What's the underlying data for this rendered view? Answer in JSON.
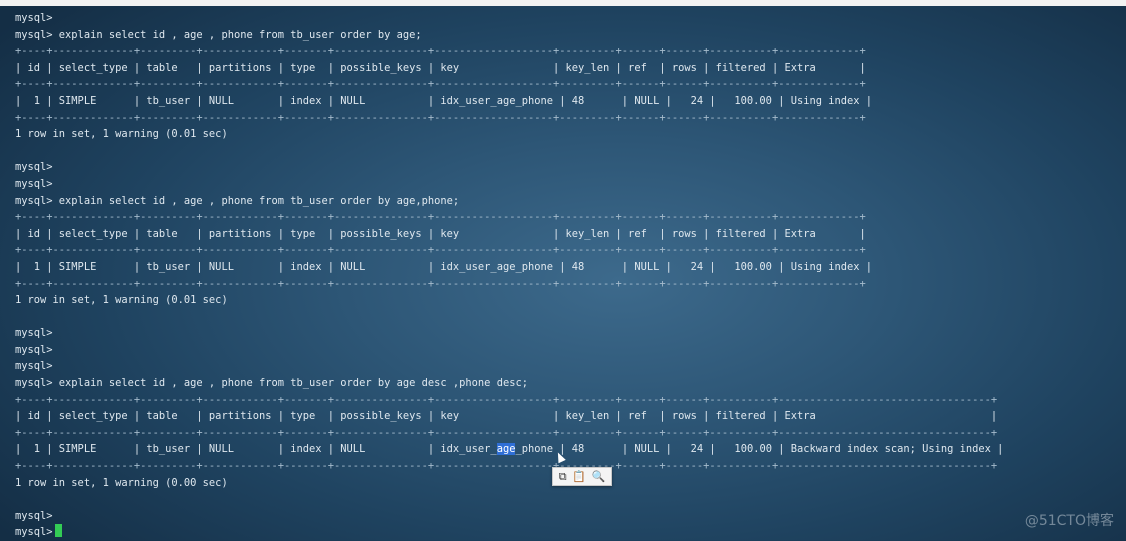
{
  "terminal": {
    "lines": [
      {
        "text": "mysql>",
        "kind": "prompt"
      },
      {
        "text": "mysql> explain select id , age , phone from tb_user order by age;",
        "kind": "prompt"
      },
      {
        "text": "+----+-------------+---------+------------+-------+---------------+-------------------+---------+------+------+----------+-------------+",
        "kind": "border"
      },
      {
        "text": "| id | select_type | table   | partitions | type  | possible_keys | key               | key_len | ref  | rows | filtered | Extra       |",
        "kind": "header"
      },
      {
        "text": "+----+-------------+---------+------------+-------+---------------+-------------------+---------+------+------+----------+-------------+",
        "kind": "border"
      },
      {
        "text": "|  1 | SIMPLE      | tb_user | NULL       | index | NULL          | idx_user_age_phone | 48      | NULL |   24 |   100.00 | Using index |",
        "kind": "row"
      },
      {
        "text": "+----+-------------+---------+------------+-------+---------------+-------------------+---------+------+------+----------+-------------+",
        "kind": "border"
      },
      {
        "text": "1 row in set, 1 warning (0.01 sec)",
        "kind": "output"
      },
      {
        "text": "",
        "kind": "blank"
      },
      {
        "text": "mysql>",
        "kind": "prompt"
      },
      {
        "text": "mysql>",
        "kind": "prompt"
      },
      {
        "text": "mysql> explain select id , age , phone from tb_user order by age,phone;",
        "kind": "prompt"
      },
      {
        "text": "+----+-------------+---------+------------+-------+---------------+-------------------+---------+------+------+----------+-------------+",
        "kind": "border"
      },
      {
        "text": "| id | select_type | table   | partitions | type  | possible_keys | key               | key_len | ref  | rows | filtered | Extra       |",
        "kind": "header"
      },
      {
        "text": "+----+-------------+---------+------------+-------+---------------+-------------------+---------+------+------+----------+-------------+",
        "kind": "border"
      },
      {
        "text": "|  1 | SIMPLE      | tb_user | NULL       | index | NULL          | idx_user_age_phone | 48      | NULL |   24 |   100.00 | Using index |",
        "kind": "row"
      },
      {
        "text": "+----+-------------+---------+------------+-------+---------------+-------------------+---------+------+------+----------+-------------+",
        "kind": "border"
      },
      {
        "text": "1 row in set, 1 warning (0.01 sec)",
        "kind": "output"
      },
      {
        "text": "",
        "kind": "blank"
      },
      {
        "text": "mysql>",
        "kind": "prompt"
      },
      {
        "text": "mysql>",
        "kind": "prompt"
      },
      {
        "text": "mysql>",
        "kind": "prompt"
      },
      {
        "text": "mysql> explain select id , age , phone from tb_user order by age desc ,phone desc;",
        "kind": "prompt"
      },
      {
        "text": "+----+-------------+---------+------------+-------+---------------+-------------------+---------+------+------+----------+----------------------------------+",
        "kind": "border"
      },
      {
        "text": "| id | select_type | table   | partitions | type  | possible_keys | key               | key_len | ref  | rows | filtered | Extra                            |",
        "kind": "header"
      },
      {
        "text": "+----+-------------+---------+------------+-------+---------------+-------------------+---------+------+------+----------+----------------------------------+",
        "kind": "border"
      },
      {
        "text_before": "|  1 | SIMPLE      | tb_user | NULL       | index | NULL          | idx_user_",
        "selected": "age",
        "text_after": "_phone | 48      | NULL |   24 |   100.00 | Backward index scan; Using index |",
        "kind": "row-selected"
      },
      {
        "text": "+----+-------------+---------+------------+-------+---------------+-------------------+---------+------+------+----------+----------------------------------+",
        "kind": "border"
      },
      {
        "text": "1 row in set, 1 warning (0.00 sec)",
        "kind": "output"
      },
      {
        "text": "",
        "kind": "blank"
      },
      {
        "text": "mysql>",
        "kind": "prompt"
      },
      {
        "text": "mysql>",
        "kind": "prompt-cursor"
      }
    ]
  },
  "popup": {
    "icons": [
      "copy-icon",
      "paste-icon",
      "search-icon"
    ],
    "glyphs": [
      "⧉",
      "📋",
      "🔍"
    ]
  },
  "watermark": "@51CTO博客"
}
